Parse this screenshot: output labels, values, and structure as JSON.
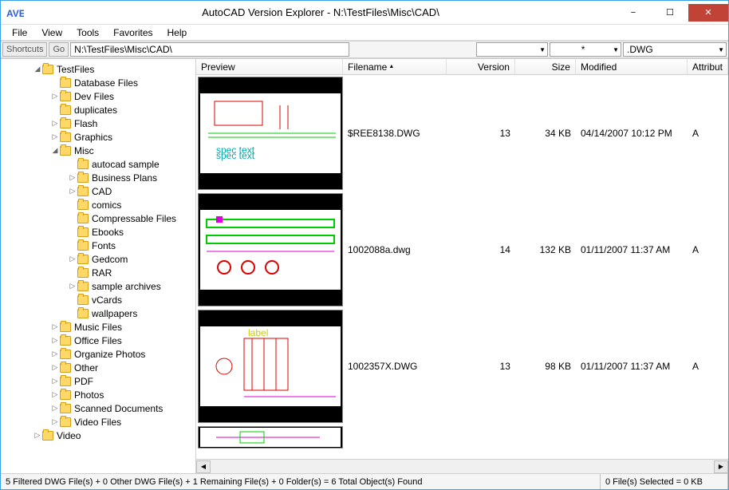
{
  "window": {
    "title": "AutoCAD Version Explorer - N:\\TestFiles\\Misc\\CAD\\",
    "app_abbr": "AVE"
  },
  "menu": {
    "file": "File",
    "view": "View",
    "tools": "Tools",
    "favorites": "Favorites",
    "help": "Help"
  },
  "toolbar": {
    "shortcuts": "Shortcuts",
    "go": "Go",
    "path_value": "N:\\TestFiles\\Misc\\CAD\\",
    "filter1": "",
    "filter2": "*",
    "ext_dd": ".DWG"
  },
  "columns": {
    "preview": "Preview",
    "filename": "Filename",
    "version": "Version",
    "size": "Size",
    "modified": "Modified",
    "attr": "Attribut"
  },
  "tree": [
    {
      "depth": 0,
      "tw": "◢",
      "label": "TestFiles"
    },
    {
      "depth": 1,
      "tw": "",
      "label": "Database Files"
    },
    {
      "depth": 1,
      "tw": "▷",
      "label": "Dev Files"
    },
    {
      "depth": 1,
      "tw": "",
      "label": "duplicates"
    },
    {
      "depth": 1,
      "tw": "▷",
      "label": "Flash"
    },
    {
      "depth": 1,
      "tw": "▷",
      "label": "Graphics"
    },
    {
      "depth": 1,
      "tw": "◢",
      "label": "Misc"
    },
    {
      "depth": 2,
      "tw": "",
      "label": "autocad sample"
    },
    {
      "depth": 2,
      "tw": "▷",
      "label": "Business Plans"
    },
    {
      "depth": 2,
      "tw": "▷",
      "label": "CAD"
    },
    {
      "depth": 2,
      "tw": "",
      "label": "comics"
    },
    {
      "depth": 2,
      "tw": "",
      "label": "Compressable Files"
    },
    {
      "depth": 2,
      "tw": "",
      "label": "Ebooks"
    },
    {
      "depth": 2,
      "tw": "",
      "label": "Fonts"
    },
    {
      "depth": 2,
      "tw": "▷",
      "label": "Gedcom"
    },
    {
      "depth": 2,
      "tw": "",
      "label": "RAR"
    },
    {
      "depth": 2,
      "tw": "▷",
      "label": "sample archives"
    },
    {
      "depth": 2,
      "tw": "",
      "label": "vCards"
    },
    {
      "depth": 2,
      "tw": "",
      "label": "wallpapers"
    },
    {
      "depth": 1,
      "tw": "▷",
      "label": "Music Files"
    },
    {
      "depth": 1,
      "tw": "▷",
      "label": "Office Files"
    },
    {
      "depth": 1,
      "tw": "▷",
      "label": "Organize Photos"
    },
    {
      "depth": 1,
      "tw": "▷",
      "label": "Other"
    },
    {
      "depth": 1,
      "tw": "▷",
      "label": "PDF"
    },
    {
      "depth": 1,
      "tw": "▷",
      "label": "Photos"
    },
    {
      "depth": 1,
      "tw": "▷",
      "label": "Scanned Documents"
    },
    {
      "depth": 1,
      "tw": "▷",
      "label": "Video Files"
    },
    {
      "depth": 0,
      "tw": "▷",
      "label": "Video"
    }
  ],
  "files": [
    {
      "filename": "$REE8138.DWG",
      "version": "13",
      "size": "34 KB",
      "modified": "04/14/2007 10:12 PM",
      "attr": "A"
    },
    {
      "filename": "1002088a.dwg",
      "version": "14",
      "size": "132 KB",
      "modified": "01/11/2007 11:37 AM",
      "attr": "A"
    },
    {
      "filename": "1002357X.DWG",
      "version": "13",
      "size": "98 KB",
      "modified": "01/11/2007 11:37 AM",
      "attr": "A"
    }
  ],
  "status": {
    "left": "5 Filtered DWG File(s) + 0 Other DWG File(s) + 1 Remaining File(s) + 0 Folder(s)  =  6 Total Object(s) Found",
    "right": "0 File(s) Selected = 0 KB"
  }
}
